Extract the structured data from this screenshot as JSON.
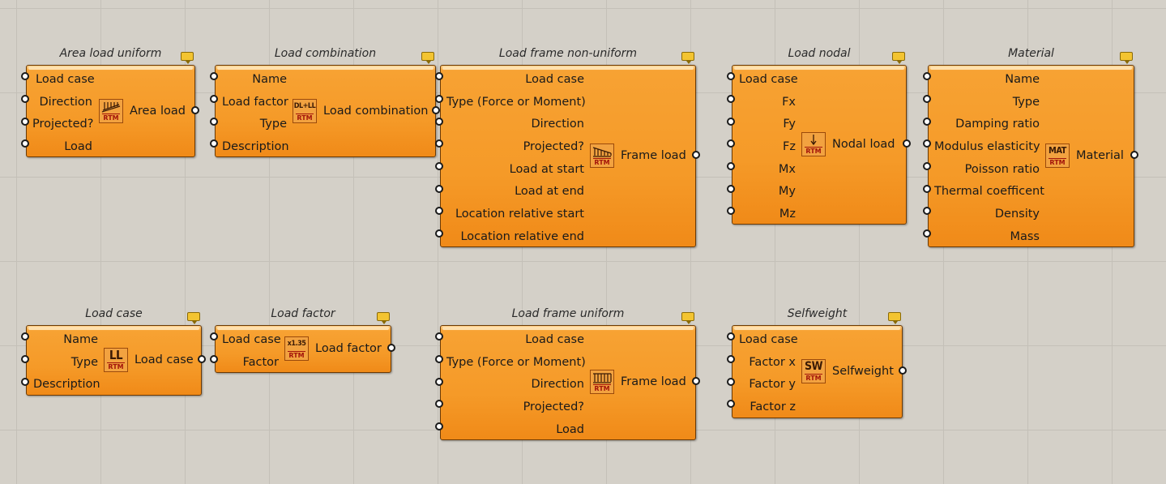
{
  "components": [
    {
      "id": "area-load-uniform",
      "title": "Area load uniform",
      "inputs": [
        "Load case",
        "Direction",
        "Projected?",
        "Load"
      ],
      "output": "Area load",
      "icon": {
        "name": "area-load-icon",
        "glyph": "",
        "sub": "RTM"
      }
    },
    {
      "id": "load-combination",
      "title": "Load combination",
      "inputs": [
        "Name",
        "Load factor",
        "Type",
        "Description"
      ],
      "output": "Load combination",
      "icon": {
        "name": "load-combination-icon",
        "glyph": "DL+LL",
        "sub": "RTM"
      }
    },
    {
      "id": "load-frame-non-uniform",
      "title": "Load frame non-uniform",
      "inputs": [
        "Load case",
        "Type (Force or Moment)",
        "Direction",
        "Projected?",
        "Load at start",
        "Load at end",
        "Location relative start",
        "Location relative end"
      ],
      "output": "Frame load",
      "icon": {
        "name": "frame-load-nonuniform-icon",
        "glyph": "",
        "sub": "RTM"
      }
    },
    {
      "id": "load-nodal",
      "title": "Load nodal",
      "inputs": [
        "Load case",
        "Fx",
        "Fy",
        "Fz",
        "Mx",
        "My",
        "Mz"
      ],
      "output": "Nodal load",
      "icon": {
        "name": "nodal-load-icon",
        "glyph": "",
        "sub": "RTM"
      }
    },
    {
      "id": "material",
      "title": "Material",
      "inputs": [
        "Name",
        "Type",
        "Damping ratio",
        "Modulus elasticity",
        "Poisson ratio",
        "Thermal coefficent",
        "Density",
        "Mass"
      ],
      "output": "Material",
      "icon": {
        "name": "material-icon",
        "glyph": "MAT",
        "sub": "RTM"
      }
    },
    {
      "id": "load-case",
      "title": "Load case",
      "inputs": [
        "Name",
        "Type",
        "Description"
      ],
      "output": "Load case",
      "icon": {
        "name": "load-case-icon",
        "glyph": "LL",
        "sub": "RTM"
      }
    },
    {
      "id": "load-factor",
      "title": "Load factor",
      "inputs": [
        "Load case",
        "Factor"
      ],
      "output": "Load factor",
      "icon": {
        "name": "load-factor-icon",
        "glyph": "x1.35",
        "sub": "RTM"
      }
    },
    {
      "id": "load-frame-uniform",
      "title": "Load frame uniform",
      "inputs": [
        "Load case",
        "Type (Force or Moment)",
        "Direction",
        "Projected?",
        "Load"
      ],
      "output": "Frame load",
      "icon": {
        "name": "frame-load-uniform-icon",
        "glyph": "",
        "sub": "RTM"
      }
    },
    {
      "id": "selfweight",
      "title": "Selfweight",
      "inputs": [
        "Load case",
        "Factor x",
        "Factor y",
        "Factor z"
      ],
      "output": "Selfweight",
      "icon": {
        "name": "selfweight-icon",
        "glyph": "SW",
        "sub": "RTM"
      }
    }
  ],
  "colors": {
    "canvas": "#d4d0c8",
    "component_fill": "#f59a28",
    "balloon": "#f3c431",
    "rtm_text": "#a3140a"
  }
}
